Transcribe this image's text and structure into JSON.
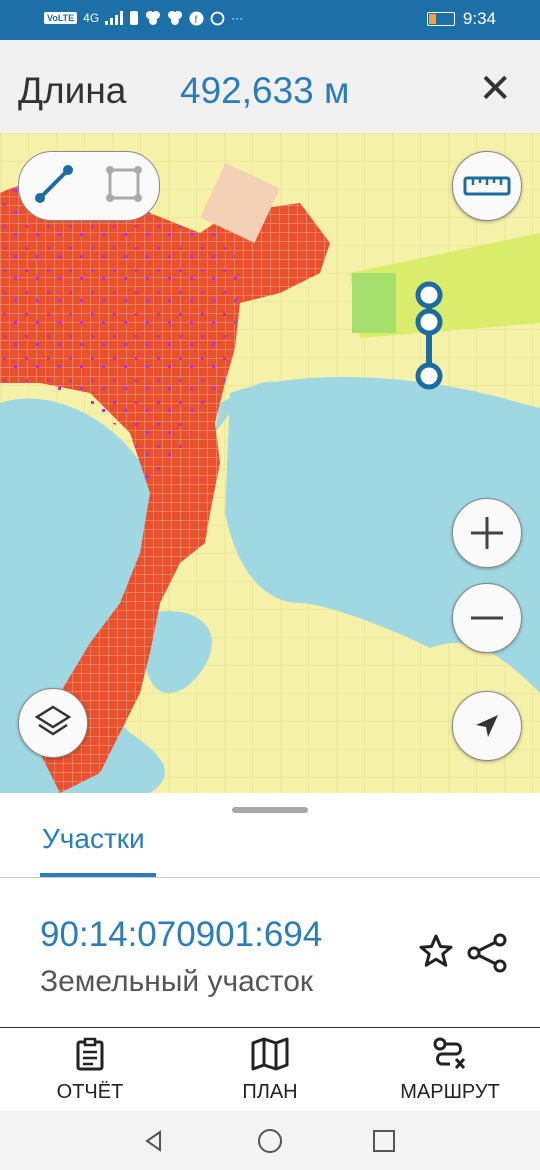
{
  "status_bar": {
    "volte": "VoLTE",
    "network": "4G",
    "time": "9:34",
    "battery_level": 0.28
  },
  "measure": {
    "label": "Длина",
    "value": "492,633 м",
    "close_icon": "close-icon"
  },
  "map": {
    "tools": [
      "line-measure-icon",
      "area-measure-icon"
    ],
    "buttons": [
      "ruler-icon",
      "zoom-in-icon",
      "zoom-out-icon",
      "locate-icon",
      "layers-icon"
    ],
    "colors": {
      "water": "#9fd8e2",
      "land": "#f6f1a8",
      "parcels": "#e8502e",
      "accent": "#1c6ca0"
    }
  },
  "sheet": {
    "tab": "Участки",
    "parcel": {
      "cadastral_number": "90:14:070901:694",
      "type": "Земельный участок"
    }
  },
  "actions": [
    {
      "label": "ОТЧЁТ",
      "icon": "report-icon"
    },
    {
      "label": "ПЛАН",
      "icon": "map-plan-icon"
    },
    {
      "label": "МАРШРУТ",
      "icon": "route-icon"
    }
  ]
}
